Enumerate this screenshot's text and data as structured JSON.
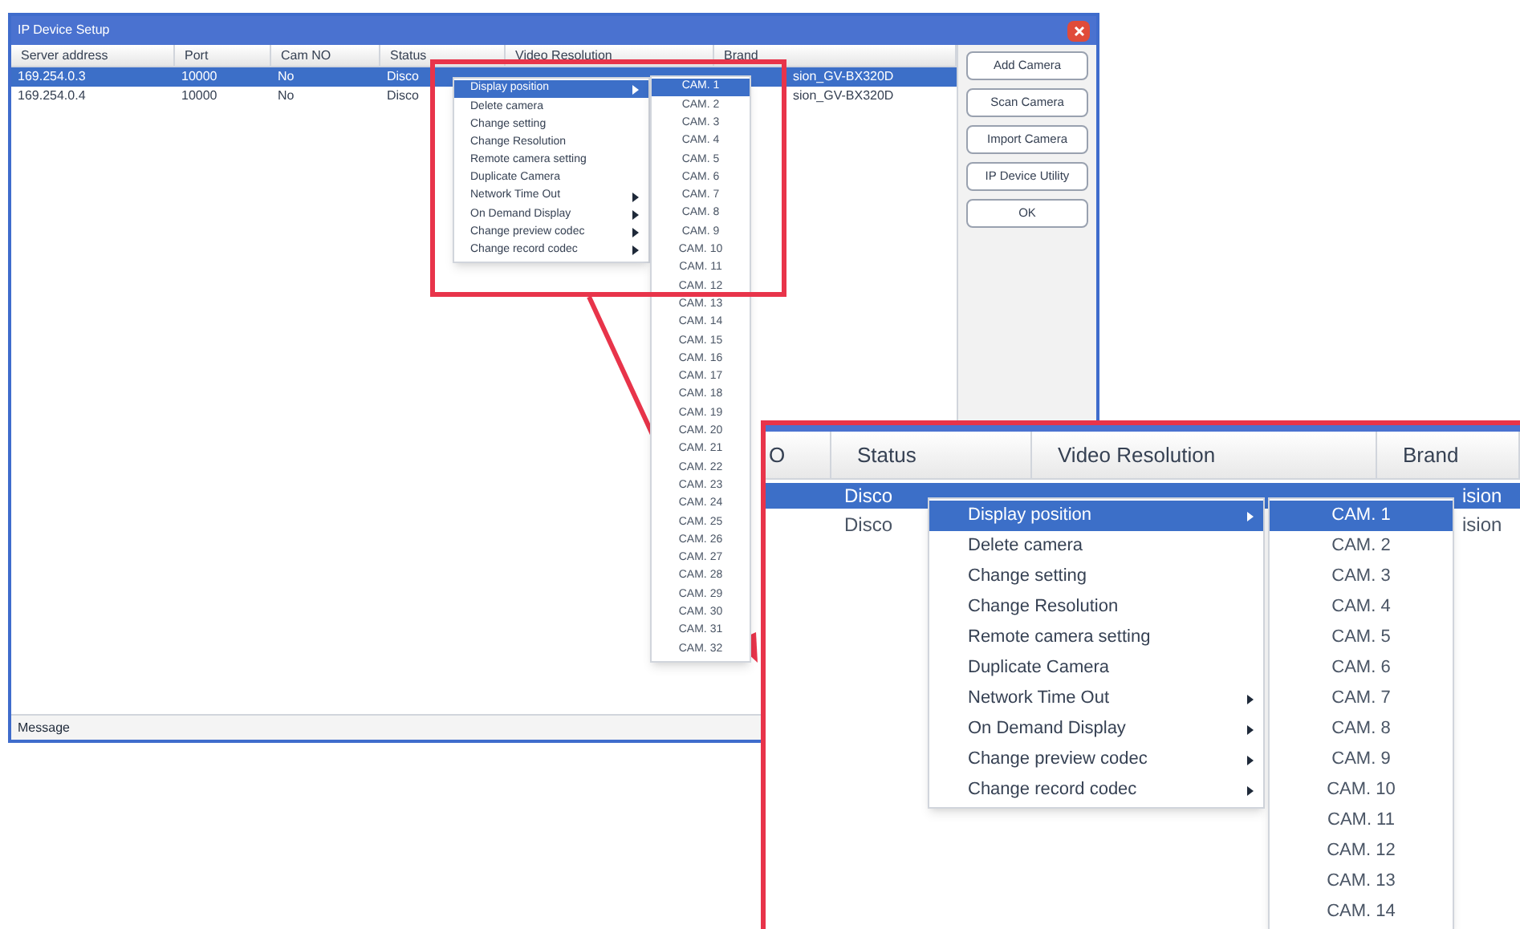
{
  "window": {
    "title": "IP Device Setup"
  },
  "table": {
    "columns": [
      "Server address",
      "Port",
      "Cam NO",
      "Status",
      "Video Resolution",
      "Brand"
    ],
    "rows": [
      {
        "selected": true,
        "cells": [
          "169.254.0.3",
          "10000",
          "No",
          "Disco",
          "",
          "sion_GV-BX320D"
        ]
      },
      {
        "selected": false,
        "cells": [
          "169.254.0.4",
          "10000",
          "No",
          "Disco",
          "",
          "sion_GV-BX320D"
        ]
      }
    ]
  },
  "buttons": [
    "Add Camera",
    "Scan Camera",
    "Import Camera",
    "IP Device Utility",
    "OK"
  ],
  "message": {
    "label": "Message"
  },
  "context_menu": [
    {
      "label": "Display position",
      "has_submenu": true,
      "selected": true
    },
    {
      "label": "Delete camera",
      "has_submenu": false,
      "selected": false
    },
    {
      "label": "Change setting",
      "has_submenu": false,
      "selected": false
    },
    {
      "label": "Change Resolution",
      "has_submenu": false,
      "selected": false
    },
    {
      "label": "Remote camera setting",
      "has_submenu": false,
      "selected": false
    },
    {
      "label": "Duplicate Camera",
      "has_submenu": false,
      "selected": false
    },
    {
      "label": "Network Time Out",
      "has_submenu": true,
      "selected": false
    },
    {
      "label": "On Demand Display",
      "has_submenu": true,
      "selected": false
    },
    {
      "label": "Change preview codec",
      "has_submenu": true,
      "selected": false
    },
    {
      "label": "Change record codec",
      "has_submenu": true,
      "selected": false
    }
  ],
  "submenu": [
    {
      "label": "CAM. 1",
      "selected": true
    },
    {
      "label": "CAM. 2",
      "selected": false
    },
    {
      "label": "CAM. 3",
      "selected": false
    },
    {
      "label": "CAM. 4",
      "selected": false
    },
    {
      "label": "CAM. 5",
      "selected": false
    },
    {
      "label": "CAM. 6",
      "selected": false
    },
    {
      "label": "CAM. 7",
      "selected": false
    },
    {
      "label": "CAM. 8",
      "selected": false
    },
    {
      "label": "CAM. 9",
      "selected": false
    },
    {
      "label": "CAM. 10",
      "selected": false
    },
    {
      "label": "CAM. 11",
      "selected": false
    },
    {
      "label": "CAM. 12",
      "selected": false
    },
    {
      "label": "CAM. 13",
      "selected": false
    },
    {
      "label": "CAM. 14",
      "selected": false
    },
    {
      "label": "CAM. 15",
      "selected": false
    },
    {
      "label": "CAM. 16",
      "selected": false
    },
    {
      "label": "CAM. 17",
      "selected": false
    },
    {
      "label": "CAM. 18",
      "selected": false
    },
    {
      "label": "CAM. 19",
      "selected": false
    },
    {
      "label": "CAM. 20",
      "selected": false
    },
    {
      "label": "CAM. 21",
      "selected": false
    },
    {
      "label": "CAM. 22",
      "selected": false
    },
    {
      "label": "CAM. 23",
      "selected": false
    },
    {
      "label": "CAM. 24",
      "selected": false
    },
    {
      "label": "CAM. 25",
      "selected": false
    },
    {
      "label": "CAM. 26",
      "selected": false
    },
    {
      "label": "CAM. 27",
      "selected": false
    },
    {
      "label": "CAM. 28",
      "selected": false
    },
    {
      "label": "CAM. 29",
      "selected": false
    },
    {
      "label": "CAM. 30",
      "selected": false
    },
    {
      "label": "CAM. 31",
      "selected": false
    },
    {
      "label": "CAM. 32",
      "selected": false
    }
  ],
  "inset": {
    "columns": [
      "O",
      "Status",
      "Video Resolution",
      "Brand"
    ],
    "rows": [
      {
        "selected": true,
        "cells": [
          "",
          "Disco",
          "",
          "ision"
        ]
      },
      {
        "selected": false,
        "cells": [
          "",
          "Disco",
          "",
          "ision"
        ]
      }
    ],
    "context_menu": [
      {
        "label": "Display position",
        "has_submenu": true,
        "selected": true
      },
      {
        "label": "Delete camera",
        "has_submenu": false,
        "selected": false
      },
      {
        "label": "Change setting",
        "has_submenu": false,
        "selected": false
      },
      {
        "label": "Change Resolution",
        "has_submenu": false,
        "selected": false
      },
      {
        "label": "Remote camera setting",
        "has_submenu": false,
        "selected": false
      },
      {
        "label": "Duplicate Camera",
        "has_submenu": false,
        "selected": false
      },
      {
        "label": "Network Time Out",
        "has_submenu": true,
        "selected": false
      },
      {
        "label": "On Demand Display",
        "has_submenu": true,
        "selected": false
      },
      {
        "label": "Change preview codec",
        "has_submenu": true,
        "selected": false
      },
      {
        "label": "Change record codec",
        "has_submenu": true,
        "selected": false
      }
    ],
    "submenu": [
      {
        "label": "CAM. 1",
        "selected": true
      },
      {
        "label": "CAM. 2",
        "selected": false
      },
      {
        "label": "CAM. 3",
        "selected": false
      },
      {
        "label": "CAM. 4",
        "selected": false
      },
      {
        "label": "CAM. 5",
        "selected": false
      },
      {
        "label": "CAM. 6",
        "selected": false
      },
      {
        "label": "CAM. 7",
        "selected": false
      },
      {
        "label": "CAM. 8",
        "selected": false
      },
      {
        "label": "CAM. 9",
        "selected": false
      },
      {
        "label": "CAM. 10",
        "selected": false
      },
      {
        "label": "CAM. 11",
        "selected": false
      },
      {
        "label": "CAM. 12",
        "selected": false
      },
      {
        "label": "CAM. 13",
        "selected": false
      },
      {
        "label": "CAM. 14",
        "selected": false
      }
    ]
  }
}
